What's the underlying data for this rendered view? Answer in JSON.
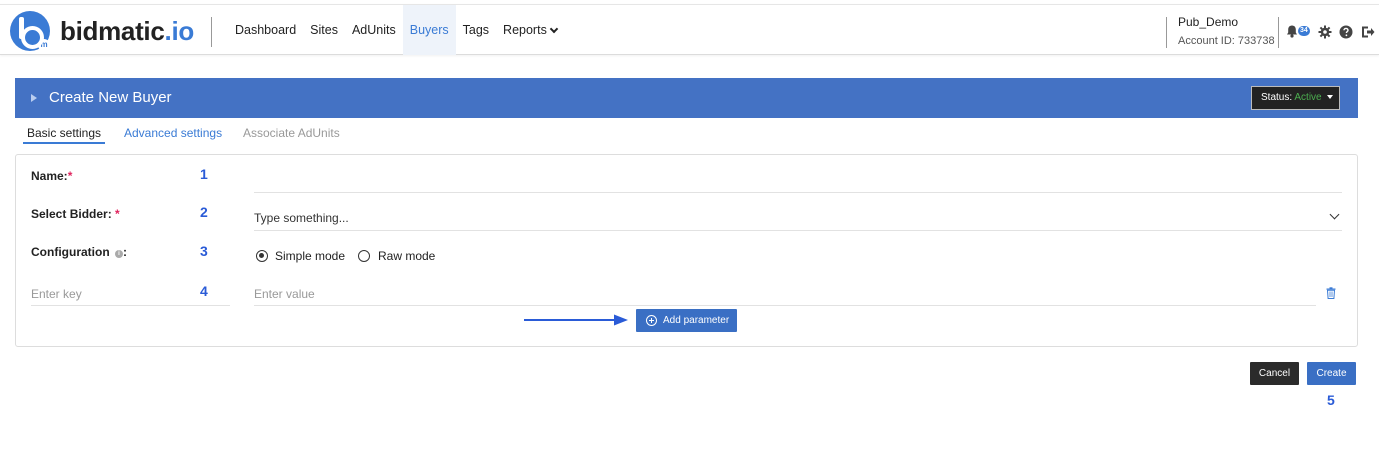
{
  "brand": {
    "name_main": "bidmatic",
    "name_suffix": ".io",
    "logo_sub": "m"
  },
  "nav": {
    "items": [
      {
        "label": "Dashboard"
      },
      {
        "label": "Sites"
      },
      {
        "label": "AdUnits"
      },
      {
        "label": "Buyers",
        "active": true
      },
      {
        "label": "Tags"
      },
      {
        "label": "Reports"
      }
    ]
  },
  "account": {
    "name": "Pub_Demo",
    "id_text": "Account ID: 733738"
  },
  "notifications": {
    "count": "34"
  },
  "header": {
    "title": "Create New Buyer",
    "status_label": "Status:",
    "status_value": "Active"
  },
  "tabs": [
    {
      "label": "Basic settings",
      "state": "active"
    },
    {
      "label": "Advanced settings",
      "state": "link"
    },
    {
      "label": "Associate AdUnits",
      "state": "disabled"
    }
  ],
  "form": {
    "name_label": "Name:",
    "bidder_label": "Select Bidder:",
    "bidder_placeholder": "Type something...",
    "config_label": "Configuration",
    "config_colon": ":",
    "modes": [
      {
        "label": "Simple mode",
        "selected": true
      },
      {
        "label": "Raw mode",
        "selected": false
      }
    ],
    "key_placeholder": "Enter key",
    "value_placeholder": "Enter value",
    "add_param_label": "Add parameter",
    "required_mark": "*"
  },
  "annotations": {
    "n1": "1",
    "n2": "2",
    "n3": "3",
    "n4": "4",
    "n5": "5"
  },
  "actions": {
    "cancel_label": "Cancel",
    "create_label": "Create"
  },
  "colors": {
    "accent": "#3a7bd5",
    "header_bar": "#4472c4",
    "required": "#e0245e",
    "status_active": "#4caf50",
    "annotation": "#2a5bd7"
  },
  "icons": [
    "bell-icon",
    "gear-icon",
    "help-icon",
    "logout-icon",
    "info-icon",
    "trash-icon",
    "plus-circle-icon",
    "chevron-down-icon"
  ]
}
